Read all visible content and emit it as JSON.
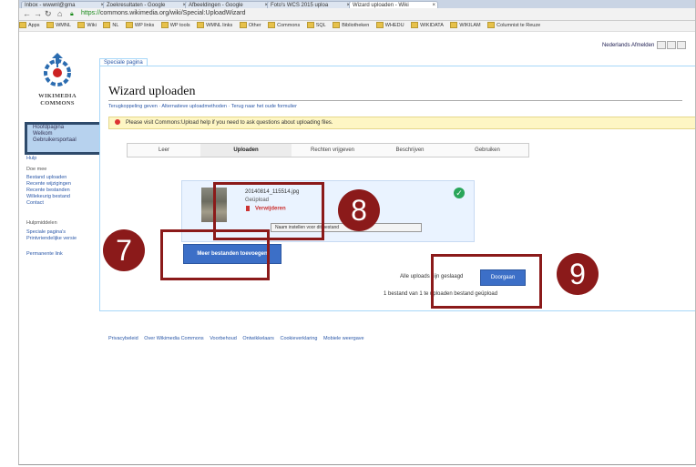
{
  "browser": {
    "tabs": [
      {
        "label": "Inbox - wwwnl@gma"
      },
      {
        "label": "Zoekresultaten - Google"
      },
      {
        "label": "Afbeeldingen - Google"
      },
      {
        "label": "Foto's WCS 2015 uploa"
      },
      {
        "label": "Wizard uploaden - Wiki"
      }
    ],
    "url_prefix": "https://",
    "url_rest": "commons.wikimedia.org/wiki/Special:UploadWizard",
    "bookmarks": [
      "Apps",
      "WMNL",
      "Wiki",
      "NL",
      "WP links",
      "WP tools",
      "WMNL links",
      "Other",
      "Commons",
      "SQL",
      "Bibliotheken",
      "WHEDU",
      "WIKIDATA",
      "WIKILAM",
      "Columnist te Reuze"
    ]
  },
  "lang_bar": "Nederlands  Afmelden",
  "sidebar": {
    "logo_text_1": "WIKIMEDIA",
    "logo_text_2": "COMMONS",
    "highlight_items": [
      "Hoofdpagina",
      "Welkom",
      "Gebruikersportaal"
    ],
    "items_1": [
      "Hulp"
    ],
    "section_1": "Doe mee",
    "items_2": [
      "Bestand uploaden",
      "Recente wijzigingen",
      "Recente bestanden",
      "Willekeurig bestand",
      "Contact"
    ],
    "section_2": "Hulpmiddelen",
    "items_3": [
      "Speciale pagina's",
      "Printvriendelijke versie",
      "Permanente link"
    ]
  },
  "page": {
    "tab_label": "Speciale pagina",
    "title": "Wizard uploaden",
    "sublinks": "Terugkoppeling geven · Alternatieve uploadmethoden · Terug naar het oude formulier",
    "notice_text": "Please visit Commons:Upload help if you need to ask questions about uploading files.",
    "steps": [
      "Leer",
      "Uploaden",
      "Rechten vrijgeven",
      "Beschrijven",
      "Gebruiken"
    ],
    "file_name": "20140814_115514.jpg",
    "file_status": "Geüpload",
    "remove_label": "Verwijderen",
    "set_button_label": "Naam instellen voor dit bestand",
    "more_button": "Meer bestanden toevoegen",
    "done_label": "Alle uploads zijn geslaagd",
    "next_button": "Doorgaan",
    "count_line": "1 bestand van 1 te uploaden bestand geüpload",
    "footer_links": [
      "Privacybeleid",
      "Over Wikimedia Commons",
      "Voorbehoud",
      "Ontwikkelaars",
      "Cookieverklaring",
      "Mobiele weergave"
    ]
  },
  "annotations": [
    "7",
    "8",
    "9"
  ],
  "colors": {
    "annotation": "#8b1a1a",
    "primary_button": "#3c6fc7",
    "highlight": "#b7d2ee"
  }
}
